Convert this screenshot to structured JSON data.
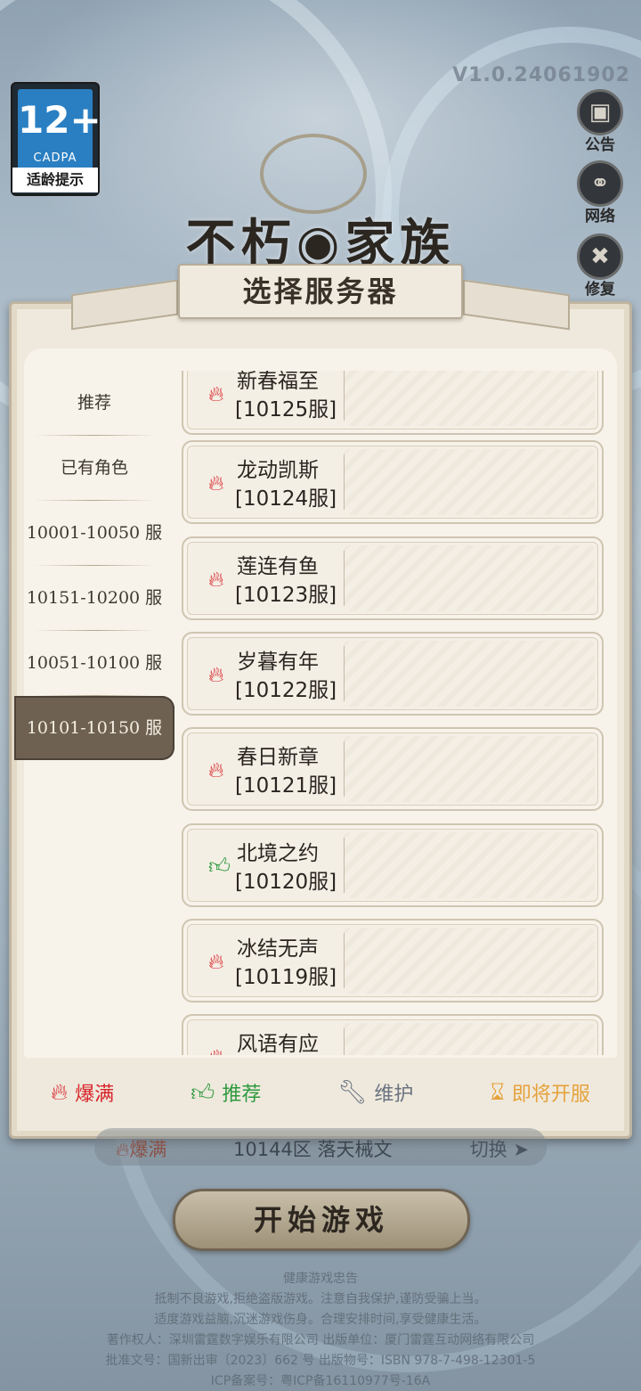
{
  "version": "V1.0.24061902",
  "age_badge": {
    "rating": "12+",
    "org": "CADPA",
    "tip": "适龄提示"
  },
  "side_buttons": [
    {
      "icon": "notice-icon",
      "label": "公告"
    },
    {
      "icon": "globe-icon",
      "label": "网络"
    },
    {
      "icon": "repair-icon",
      "label": "修复"
    }
  ],
  "game_title": "不朽◉家族",
  "modal": {
    "title": "选择服务器",
    "categories": [
      {
        "label": "推荐",
        "active": false
      },
      {
        "label": "已有角色",
        "active": false
      },
      {
        "label": "10001-10050 服",
        "active": false
      },
      {
        "label": "10151-10200 服",
        "active": false
      },
      {
        "label": "10051-10100 服",
        "active": false
      },
      {
        "label": "10101-10150 服",
        "active": true
      }
    ],
    "servers": [
      {
        "name": "新春福至",
        "id": "[10125服]",
        "status": "hot"
      },
      {
        "name": "龙动凯斯",
        "id": "[10124服]",
        "status": "hot"
      },
      {
        "name": "莲连有鱼",
        "id": "[10123服]",
        "status": "hot"
      },
      {
        "name": "岁暮有年",
        "id": "[10122服]",
        "status": "hot"
      },
      {
        "name": "春日新章",
        "id": "[10121服]",
        "status": "hot"
      },
      {
        "name": "北境之约",
        "id": "[10120服]",
        "status": "recommended"
      },
      {
        "name": "冰结无声",
        "id": "[10119服]",
        "status": "hot"
      },
      {
        "name": "风语有应",
        "id": "",
        "status": "hot"
      }
    ],
    "legend": [
      {
        "icon": "fire-icon",
        "label": "爆满",
        "color": "#d8232a"
      },
      {
        "icon": "thumbs-up-icon",
        "label": "推荐",
        "color": "#2f9a3f"
      },
      {
        "icon": "wrench-icon",
        "label": "维护",
        "color": "#6a7380"
      },
      {
        "icon": "hourglass-icon",
        "label": "即将开服",
        "color": "#e6a23c"
      }
    ]
  },
  "current": {
    "status": "爆满",
    "server": "10144区 落天械文",
    "switch": "切换"
  },
  "start_button": "开始游戏",
  "footer": [
    "健康游戏忠告",
    "抵制不良游戏,拒绝盗版游戏。注意自我保护,谨防受骗上当。",
    "适度游戏益脑,沉迷游戏伤身。合理安排时间,享受健康生活。",
    "著作权人：深圳雷霆数字娱乐有限公司 出版单位：厦门雷霆互动网络有限公司",
    "批准文号：国新出审〔2023〕662 号 出版物号：ISBN 978-7-498-12301-5",
    "ICP备案号：粤ICP备16110977号-16A"
  ]
}
